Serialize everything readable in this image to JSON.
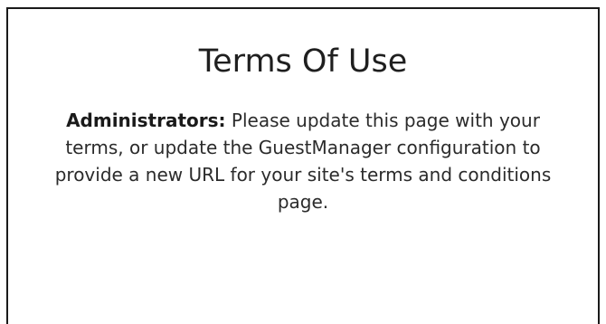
{
  "page": {
    "title": "Terms Of Use",
    "notice": {
      "label": "Administrators:",
      "text": "Please update this page with your terms, or update the GuestManager configuration to provide a new URL for your site's terms and conditions page."
    }
  }
}
